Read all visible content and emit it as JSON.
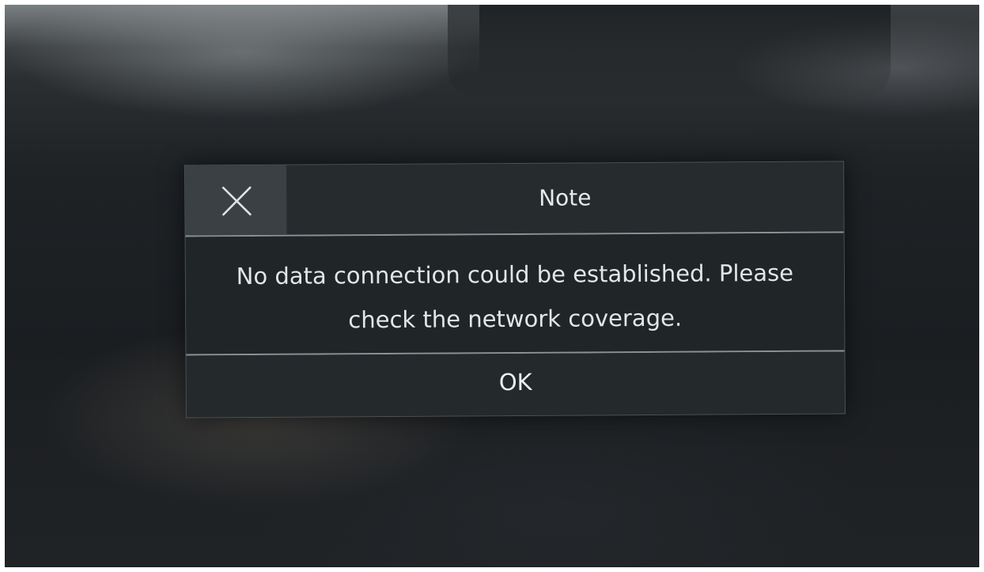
{
  "dialog": {
    "title": "Note",
    "message": "No data connection could be established. Please check the network coverage.",
    "ok_label": "OK",
    "close_icon": "close-icon"
  },
  "colors": {
    "dialog_background": "#24292c",
    "close_button_background": "#3a4043",
    "divider": "#8b9296",
    "text": "#e6eaec"
  }
}
